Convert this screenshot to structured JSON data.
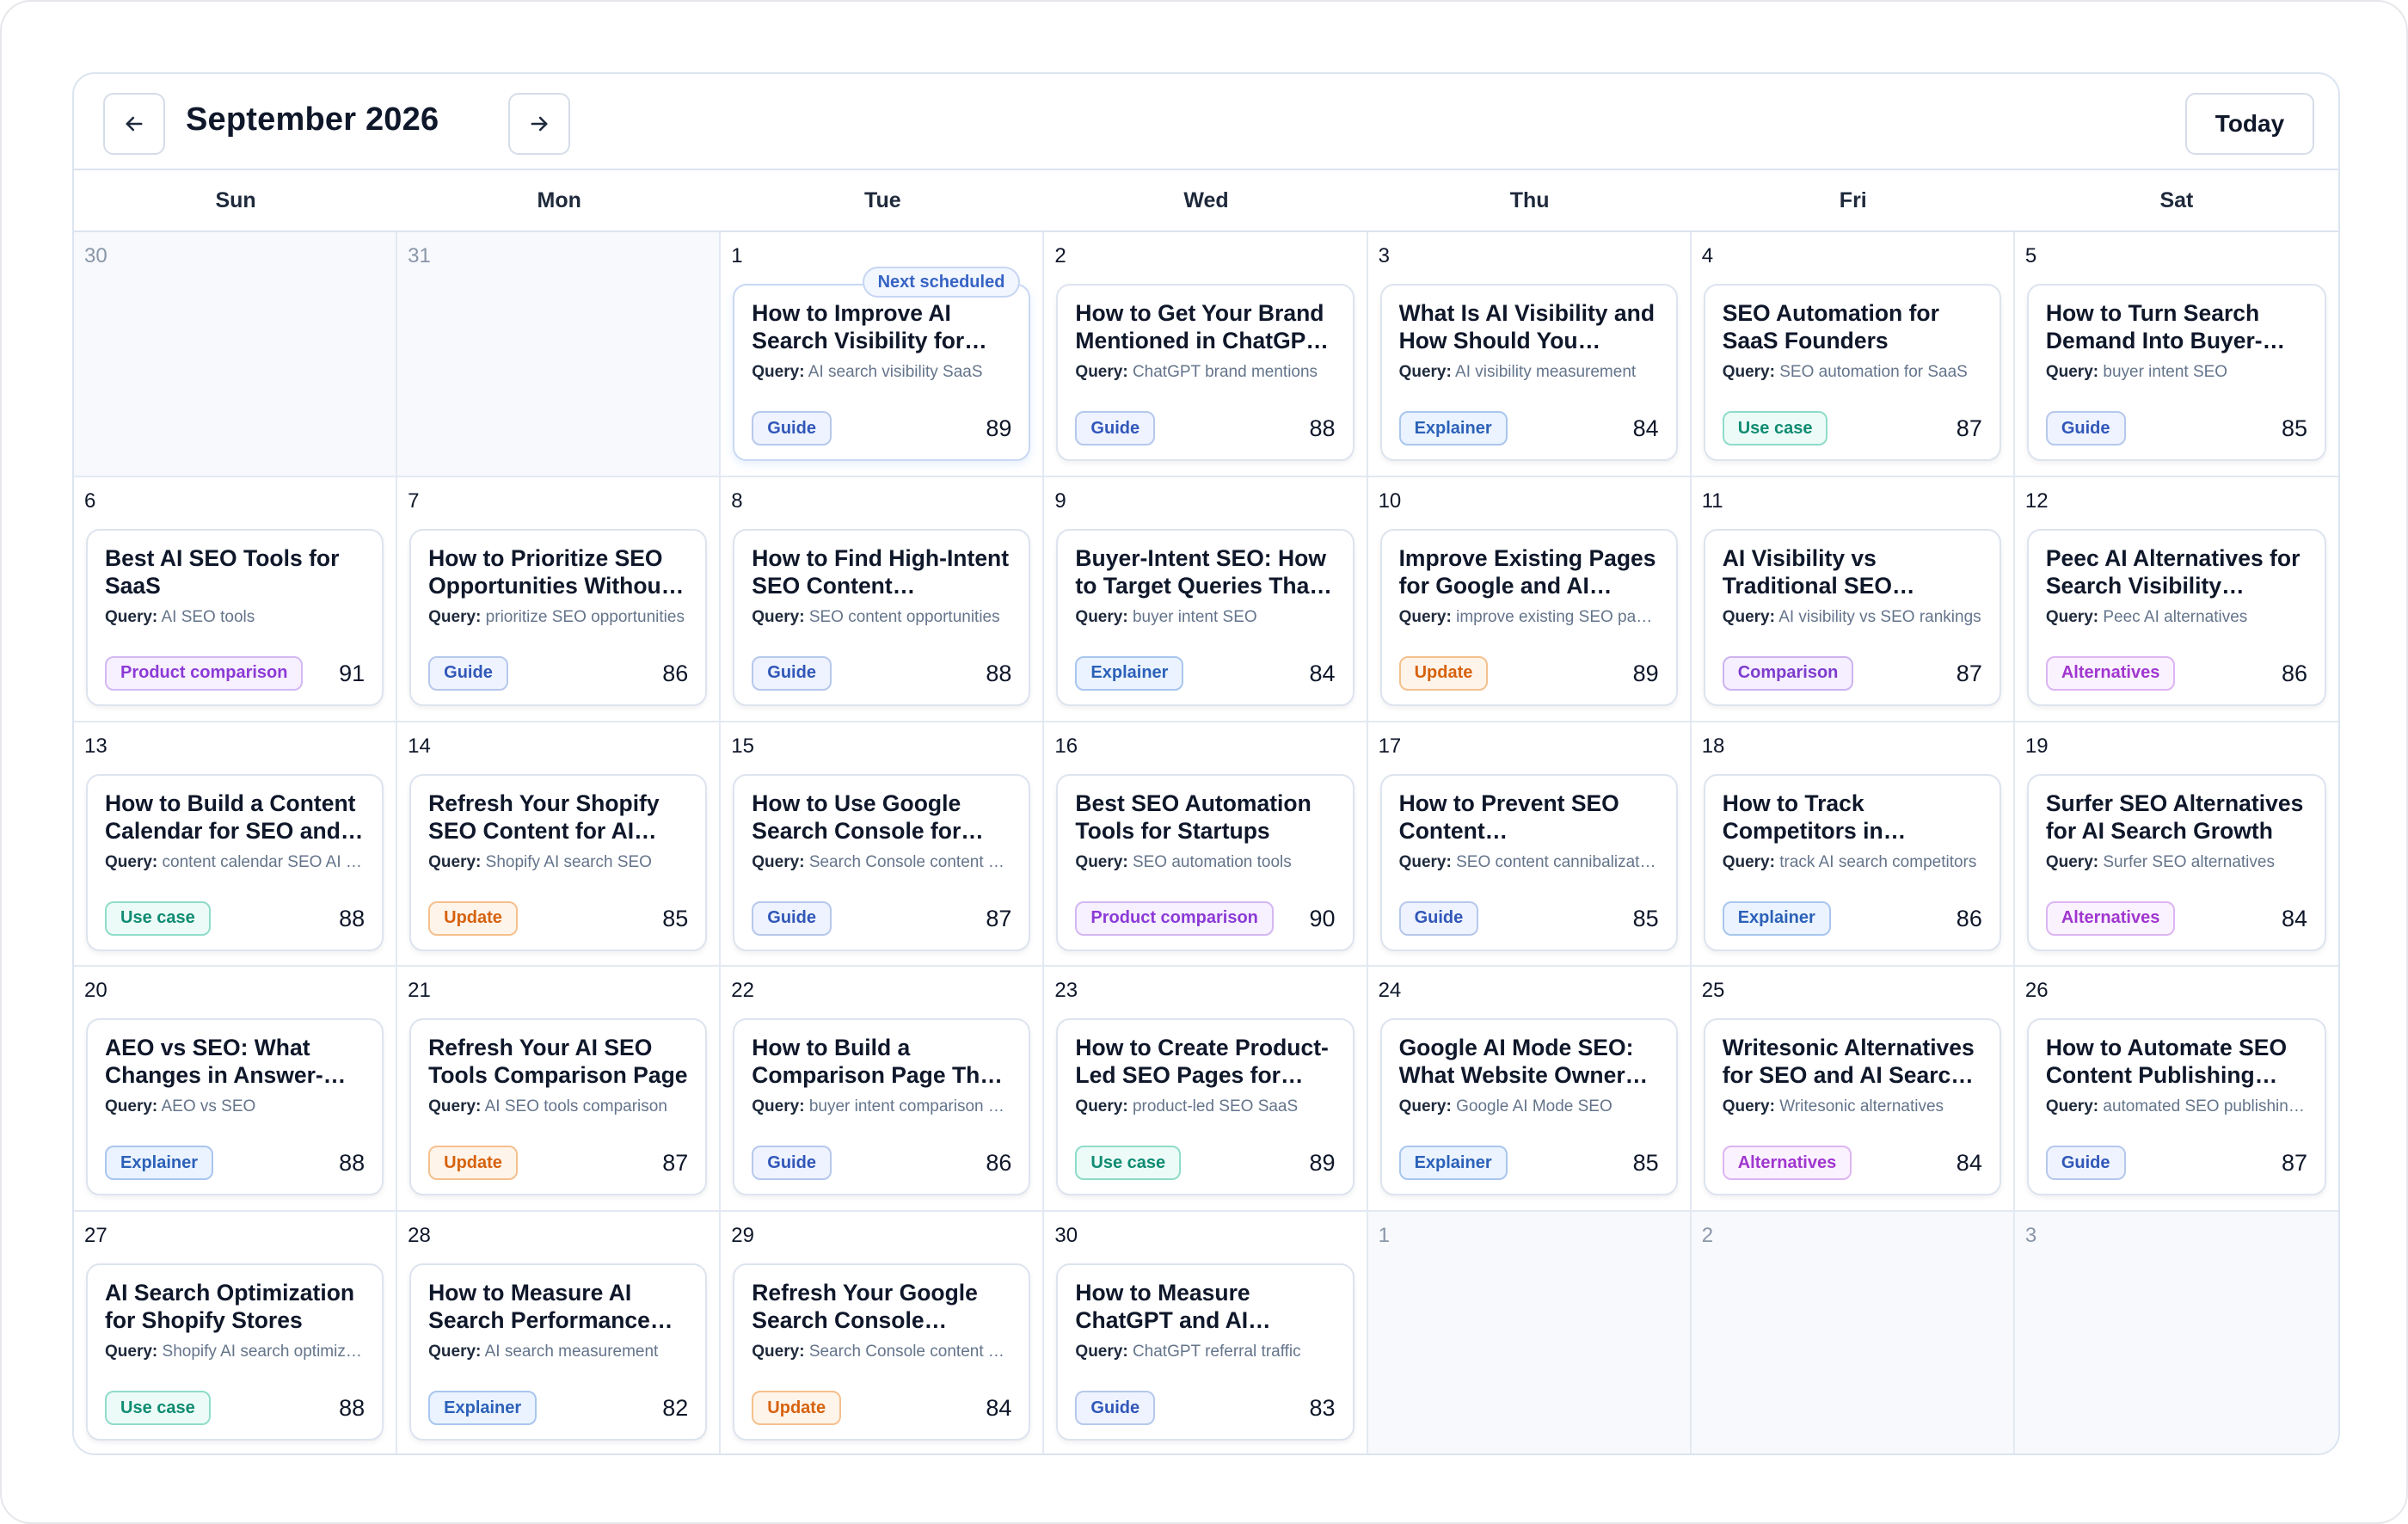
{
  "header": {
    "title": "September 2026",
    "prev_icon": "arrow-left-icon",
    "next_icon": "arrow-right-icon",
    "today_label": "Today"
  },
  "weekdays": [
    "Sun",
    "Mon",
    "Tue",
    "Wed",
    "Thu",
    "Fri",
    "Sat"
  ],
  "query_label": "Query:",
  "next_scheduled_label": "Next scheduled",
  "tag_colors": {
    "Guide": "#3157b8",
    "Explainer": "#2c61b8",
    "Use case": "#0f8c72",
    "Product comparison": "#8c3ad6",
    "Update": "#d6620e",
    "Comparison": "#7e3ccd",
    "Alternatives": "#a036cf"
  },
  "days": [
    {
      "day": "30",
      "muted": true
    },
    {
      "day": "31",
      "muted": true
    },
    {
      "day": "1",
      "next": true,
      "card": {
        "title": "How to Improve AI Search Visibility for SaaS",
        "query": "AI search visibility SaaS",
        "tag": "Guide",
        "score": "89"
      }
    },
    {
      "day": "2",
      "card": {
        "title": "How to Get Your Brand Mentioned in ChatGPT Answers",
        "query": "ChatGPT brand mentions",
        "tag": "Guide",
        "score": "88"
      }
    },
    {
      "day": "3",
      "card": {
        "title": "What Is AI Visibility and How Should You Measure It",
        "query": "AI visibility measurement",
        "tag": "Explainer",
        "score": "84"
      }
    },
    {
      "day": "4",
      "card": {
        "title": "SEO Automation for SaaS Founders",
        "query": "SEO automation for SaaS",
        "tag": "Use case",
        "score": "87"
      }
    },
    {
      "day": "5",
      "card": {
        "title": "How to Turn Search Demand Into Buyer-Intent Content",
        "query": "buyer intent SEO",
        "tag": "Guide",
        "score": "85"
      }
    },
    {
      "day": "6",
      "card": {
        "title": "Best AI SEO Tools for SaaS",
        "query": "AI SEO tools",
        "tag": "Product comparison",
        "score": "91"
      }
    },
    {
      "day": "7",
      "card": {
        "title": "How to Prioritize SEO Opportunities Without Guesswork",
        "query": "prioritize SEO opportunities",
        "tag": "Guide",
        "score": "86"
      }
    },
    {
      "day": "8",
      "card": {
        "title": "How to Find High-Intent SEO Content Opportunities",
        "query": "SEO content opportunities",
        "tag": "Guide",
        "score": "88"
      }
    },
    {
      "day": "9",
      "card": {
        "title": "Buyer-Intent SEO: How to Target Queries That Convert",
        "query": "buyer intent SEO",
        "tag": "Explainer",
        "score": "84"
      }
    },
    {
      "day": "10",
      "card": {
        "title": "Improve Existing Pages for Google and AI Search",
        "query": "improve existing SEO pages",
        "tag": "Update",
        "score": "89"
      }
    },
    {
      "day": "11",
      "card": {
        "title": "AI Visibility vs Traditional SEO Rankings",
        "query": "AI visibility vs SEO rankings",
        "tag": "Comparison",
        "score": "87"
      }
    },
    {
      "day": "12",
      "card": {
        "title": "Peec AI Alternatives for Search Visibility Tracking",
        "query": "Peec AI alternatives",
        "tag": "Alternatives",
        "score": "86"
      }
    },
    {
      "day": "13",
      "card": {
        "title": "How to Build a Content Calendar for SEO and AI Search",
        "query": "content calendar SEO AI search",
        "tag": "Use case",
        "score": "88"
      }
    },
    {
      "day": "14",
      "card": {
        "title": "Refresh Your Shopify SEO Content for AI Search",
        "query": "Shopify AI search SEO",
        "tag": "Update",
        "score": "85"
      }
    },
    {
      "day": "15",
      "card": {
        "title": "How to Use Google Search Console for Content Planning",
        "query": "Search Console content planning",
        "tag": "Guide",
        "score": "87"
      }
    },
    {
      "day": "16",
      "card": {
        "title": "Best SEO Automation Tools for Startups",
        "query": "SEO automation tools",
        "tag": "Product comparison",
        "score": "90"
      }
    },
    {
      "day": "17",
      "card": {
        "title": "How to Prevent SEO Content Cannibalization",
        "query": "SEO content cannibalization",
        "tag": "Guide",
        "score": "85"
      }
    },
    {
      "day": "18",
      "card": {
        "title": "How to Track Competitors in ChatGPT and AI Search",
        "query": "track AI search competitors",
        "tag": "Explainer",
        "score": "86"
      }
    },
    {
      "day": "19",
      "card": {
        "title": "Surfer SEO Alternatives for AI Search Growth",
        "query": "Surfer SEO alternatives",
        "tag": "Alternatives",
        "score": "84"
      }
    },
    {
      "day": "20",
      "card": {
        "title": "AEO vs SEO: What Changes in Answer-Engine Search",
        "query": "AEO vs SEO",
        "tag": "Explainer",
        "score": "88"
      }
    },
    {
      "day": "21",
      "card": {
        "title": "Refresh Your AI SEO Tools Comparison Page",
        "query": "AI SEO tools comparison",
        "tag": "Update",
        "score": "87"
      }
    },
    {
      "day": "22",
      "card": {
        "title": "How to Build a Comparison Page That Converts",
        "query": "buyer intent comparison pages",
        "tag": "Guide",
        "score": "86"
      }
    },
    {
      "day": "23",
      "card": {
        "title": "How to Create Product-Led SEO Pages for SaaS",
        "query": "product-led SEO SaaS",
        "tag": "Use case",
        "score": "89"
      }
    },
    {
      "day": "24",
      "card": {
        "title": "Google AI Mode SEO: What Website Owners Should Know",
        "query": "Google AI Mode SEO",
        "tag": "Explainer",
        "score": "85"
      }
    },
    {
      "day": "25",
      "card": {
        "title": "Writesonic Alternatives for SEO and AI Search Visibility",
        "query": "Writesonic alternatives",
        "tag": "Alternatives",
        "score": "84"
      }
    },
    {
      "day": "26",
      "card": {
        "title": "How to Automate SEO Content Publishing Workflows",
        "query": "automated SEO publishing workflow",
        "tag": "Guide",
        "score": "87"
      }
    },
    {
      "day": "27",
      "card": {
        "title": "AI Search Optimization for Shopify Stores",
        "query": "Shopify AI search optimization",
        "tag": "Use case",
        "score": "88"
      }
    },
    {
      "day": "28",
      "card": {
        "title": "How to Measure AI Search Performance and ROI",
        "query": "AI search measurement",
        "tag": "Explainer",
        "score": "82"
      }
    },
    {
      "day": "29",
      "card": {
        "title": "Refresh Your Google Search Console Content Workflow",
        "query": "Search Console content workflow",
        "tag": "Update",
        "score": "84"
      }
    },
    {
      "day": "30",
      "card": {
        "title": "How to Measure ChatGPT and AI Referral Traffic",
        "query": "ChatGPT referral traffic",
        "tag": "Guide",
        "score": "83"
      }
    },
    {
      "day": "1",
      "muted": true
    },
    {
      "day": "2",
      "muted": true
    },
    {
      "day": "3",
      "muted": true
    }
  ]
}
